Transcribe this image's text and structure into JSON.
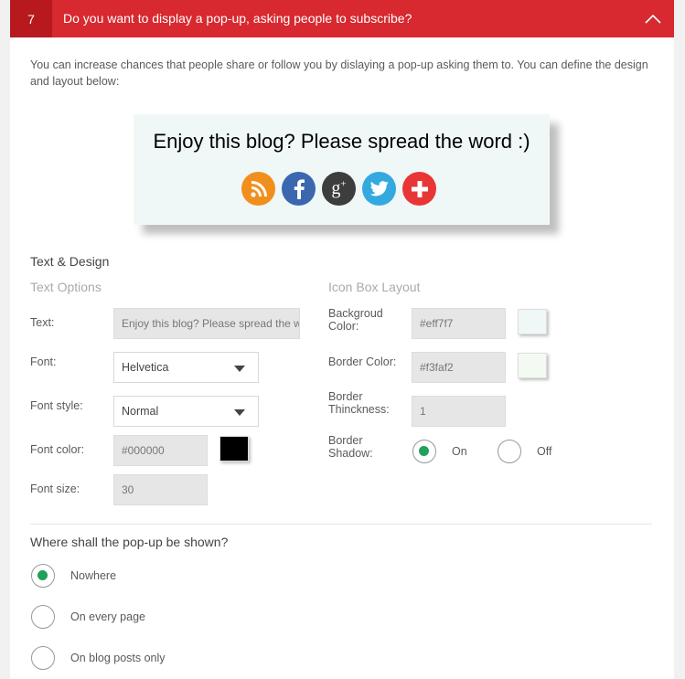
{
  "header": {
    "step_number": "7",
    "title": "Do you want to display a pop-up, asking people to subscribe?"
  },
  "description": "You can increase chances that people share or follow you by dislaying a pop-up asking them to. You can define the design and layout below:",
  "preview": {
    "text": "Enjoy this blog? Please spread the word :)",
    "icons": [
      {
        "name": "rss-icon",
        "color": "#f18f1d"
      },
      {
        "name": "facebook-icon",
        "color": "#3b67ae"
      },
      {
        "name": "google-plus-icon",
        "color": "#3d3d3d"
      },
      {
        "name": "twitter-icon",
        "color": "#33a9e0"
      },
      {
        "name": "share-plus-icon",
        "color": "#e83636"
      }
    ]
  },
  "text_design": {
    "section_title": "Text & Design",
    "text_options_title": "Text Options",
    "icon_box_title": "Icon Box Layout",
    "text_label": "Text:",
    "text_value": "Enjoy this blog? Please spread the word :)",
    "font_label": "Font:",
    "font_value": "Helvetica",
    "font_style_label": "Font style:",
    "font_style_value": "Normal",
    "font_color_label": "Font color:",
    "font_color_value": "#000000",
    "font_size_label": "Font size:",
    "font_size_value": "30",
    "bg_color_label_1": "Backgroud",
    "bg_color_label_2": "Color:",
    "bg_color_value": "#eff7f7",
    "border_color_label": "Border Color:",
    "border_color_value": "#f3faf2",
    "border_thickness_label_1": "Border",
    "border_thickness_label_2": "Thinckness:",
    "border_thickness_value": "1",
    "border_shadow_label_1": "Border",
    "border_shadow_label_2": "Shadow:",
    "shadow_on_label": "On",
    "shadow_off_label": "Off",
    "shadow_selected": "On"
  },
  "placement": {
    "question": "Where shall the pop-up be shown?",
    "options": [
      "Nowhere",
      "On every page",
      "On blog posts only"
    ],
    "selected": "Nowhere"
  }
}
